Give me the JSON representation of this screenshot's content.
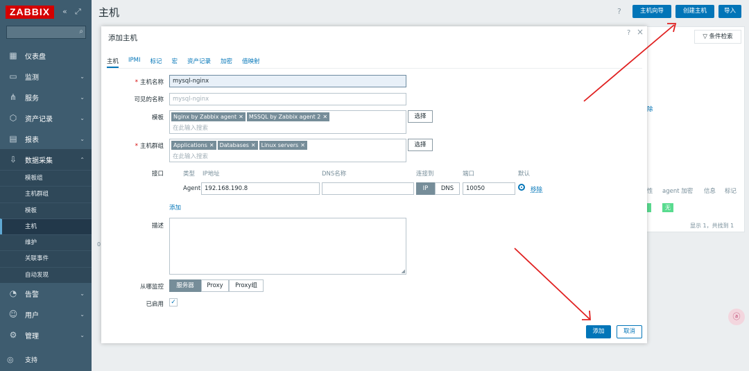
{
  "app": {
    "logo": "ZABBIX",
    "collapse_icon": "«",
    "kiosk_icon": "⤢"
  },
  "sidebar": {
    "menu": [
      {
        "label": "仪表盘",
        "icon": "▦"
      },
      {
        "label": "监测",
        "icon": "▭"
      },
      {
        "label": "服务",
        "icon": "⋔"
      },
      {
        "label": "资产记录",
        "icon": "⬡"
      },
      {
        "label": "报表",
        "icon": "▤"
      },
      {
        "label": "数据采集",
        "icon": "⇩"
      },
      {
        "label": "告警",
        "icon": "◔"
      },
      {
        "label": "用户",
        "icon": "☺"
      },
      {
        "label": "管理",
        "icon": "⚙"
      }
    ],
    "submenu": [
      "模板组",
      "主机群组",
      "模板",
      "主机",
      "维护",
      "关联事件",
      "自动发现"
    ],
    "support": "支持",
    "chevron_down": "⌄",
    "chevron_up": "⌃"
  },
  "header": {
    "title": "主机",
    "help": "?",
    "buttons": [
      "主机向导",
      "创建主机",
      "导入"
    ]
  },
  "background": {
    "filter_tab": "条件检索",
    "filter_icon": "▽",
    "link_fragment": "除",
    "columns": [
      "性",
      "agent 加密",
      "信息",
      "标记"
    ],
    "badge": "无",
    "count": "显示 1，共找到 1",
    "left_digit": "0"
  },
  "modal": {
    "title": "添加主机",
    "help": "?",
    "close": "×",
    "tabs": [
      "主机",
      "IPMI",
      "标记",
      "宏",
      "资产记录",
      "加密",
      "值映射"
    ],
    "labels": {
      "host_name": "主机名称",
      "visible_name": "可见的名称",
      "templates": "模板",
      "host_groups": "主机群组",
      "interfaces": "接口",
      "description": "描述",
      "monitored_by": "从哪监控",
      "enabled": "已启用"
    },
    "required_mark": "*",
    "host_name_value": "mysql-nginx",
    "visible_name_placeholder": "mysql-nginx",
    "templates": [
      "Nginx by Zabbix agent",
      "MSSQL by Zabbix agent 2"
    ],
    "groups": [
      "Applications",
      "Databases",
      "Linux servers"
    ],
    "chip_remove": "✕",
    "search_placeholder": "在此输入搜索",
    "select_button": "选择",
    "interface_headers": [
      "类型",
      "IP地址",
      "DNS名称",
      "连接到",
      "端口",
      "默认"
    ],
    "interface": {
      "type": "Agent",
      "ip": "192.168.190.8",
      "dns": "",
      "connect_ip": "IP",
      "connect_dns": "DNS",
      "port": "10050",
      "remove": "移除"
    },
    "add_link": "添加",
    "monitored_by_options": [
      "服务器",
      "Proxy",
      "Proxy组"
    ],
    "enabled_check": "✓",
    "footer": {
      "add": "添加",
      "cancel": "取消"
    }
  },
  "floating_badge": "ⓐ"
}
